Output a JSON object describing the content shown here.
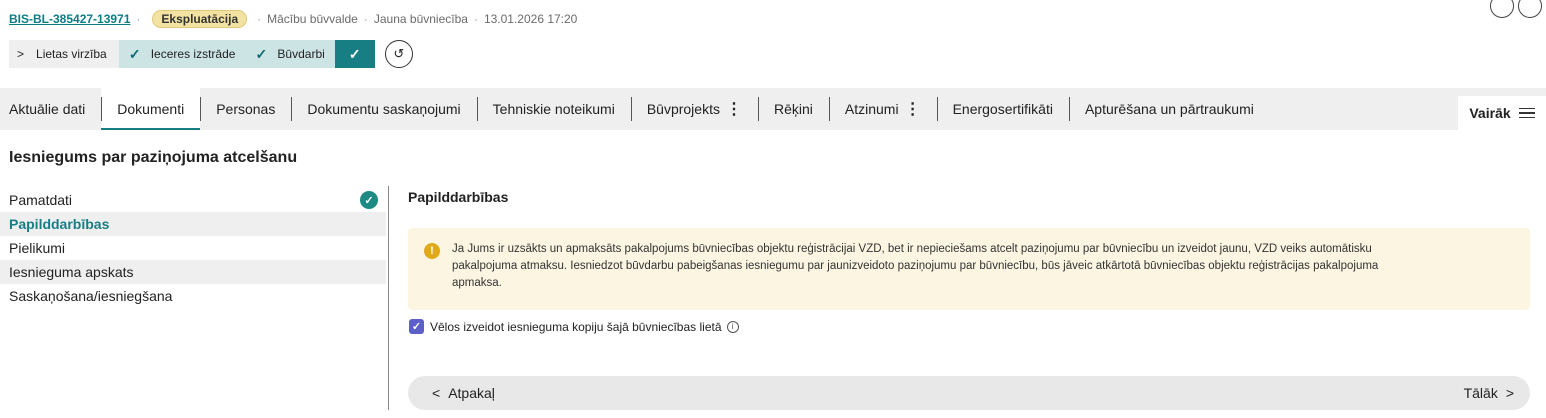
{
  "header": {
    "case_id": "BIS-BL-385427-13971",
    "status_badge": "Ekspluatācija",
    "authority": "Mācību būvvalde",
    "case_type": "Jauna būvniecība",
    "datetime": "13.01.2026 17:20",
    "separator": "·"
  },
  "stages": {
    "start_label": "Lietas virzība",
    "items": [
      {
        "label": "Ieceres izstrāde",
        "state": "done"
      },
      {
        "label": "Būvdarbi",
        "state": "done"
      }
    ]
  },
  "tabs": [
    {
      "label": "Aktuālie dati"
    },
    {
      "label": "Dokumenti",
      "active": true
    },
    {
      "label": "Personas"
    },
    {
      "label": "Dokumentu saskaņojumi"
    },
    {
      "label": "Tehniskie noteikumi"
    },
    {
      "label": "Būvprojekts",
      "menu": true
    },
    {
      "label": "Rēķini"
    },
    {
      "label": "Atzinumi",
      "menu": true
    },
    {
      "label": "Energosertifikāti"
    },
    {
      "label": "Apturēšana un pārtraukumi"
    }
  ],
  "more_label": "Vairāk",
  "page_title": "Iesniegums par paziņojuma atcelšanu",
  "leftnav": [
    {
      "label": "Pamatdati",
      "done": true
    },
    {
      "label": "Papilddarbības",
      "active": true
    },
    {
      "label": "Pielikumi"
    },
    {
      "label": "Iesnieguma apskats"
    },
    {
      "label": "Saskaņošana/iesniegšana"
    }
  ],
  "section_title": "Papilddarbības",
  "notice_text": "Ja Jums ir uzsākts un apmaksāts pakalpojums būvniecības objektu reģistrācijai VZD, bet ir nepieciešams atcelt paziņojumu par būvniecību un izveidot jaunu, VZD veiks automātisku pakalpojuma atmaksu. Iesniedzot būvdarbu pabeigšanas iesniegumu par jaunizveidoto paziņojumu par būvniecību, būs jāveic atkārtotā būvniecības objektu reģistrācijas pakalpojuma apmaksa.",
  "checkbox": {
    "label": "Vēlos izveidot iesnieguma kopiju šajā būvniecības lietā",
    "checked": true
  },
  "nav": {
    "back_label": "Atpakaļ",
    "next_label": "Tālāk"
  },
  "colors": {
    "accent": "#177f84",
    "stage_done_bg": "#cde4e5",
    "badge_bg": "#f3e3a3",
    "notice_bg": "#fcf5e1",
    "checkbox": "#5b5fc7"
  },
  "icons": {
    "stage_done": "check-icon",
    "history": "history-icon",
    "more": "hamburger-icon",
    "warning": "warning-icon",
    "info": "info-icon"
  }
}
